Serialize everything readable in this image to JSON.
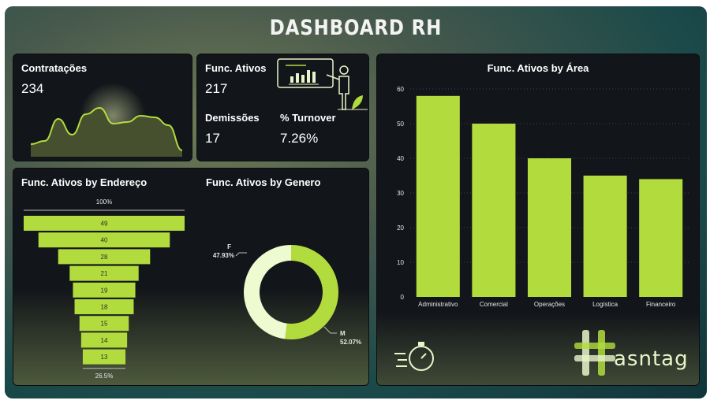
{
  "header": {
    "title": "DASHBOARD RH"
  },
  "cards": {
    "contratacoes": {
      "label": "Contratações",
      "value": "234"
    },
    "ativos": {
      "label": "Func. Ativos",
      "value": "217"
    },
    "demissoes": {
      "label": "Demissões",
      "value": "17"
    },
    "turnover": {
      "label": "% Turnover",
      "value": "7.26%"
    }
  },
  "sparkline": {
    "values": [
      8,
      10,
      24,
      14,
      27,
      31,
      21,
      22,
      26,
      25,
      20,
      4
    ]
  },
  "chart_data": [
    {
      "type": "bar",
      "title": "Func. Ativos by Endereço",
      "orientation": "funnel",
      "values": [
        49,
        40,
        28,
        21,
        19,
        18,
        15,
        14,
        13
      ],
      "top_label": "100%",
      "bottom_label": "26.5%"
    },
    {
      "type": "pie",
      "title": "Func. Ativos by Genero",
      "slices": [
        {
          "name": "F",
          "percent": "47.93%",
          "value": 47.93,
          "color": "#eefad0"
        },
        {
          "name": "M",
          "percent": "52.07%",
          "value": 52.07,
          "color": "#b2dc3e"
        }
      ]
    },
    {
      "type": "bar",
      "title": "Func. Ativos by Área",
      "categories": [
        "Administrativo",
        "Comercial",
        "Operações",
        "Logística",
        "Financeiro"
      ],
      "values": [
        58,
        50,
        40,
        35,
        34
      ],
      "yticks": [
        "0",
        "10",
        "20",
        "30",
        "40",
        "50",
        "60"
      ],
      "ylim": [
        0,
        60
      ]
    }
  ],
  "branding": {
    "logo_text": "asntag"
  },
  "colors": {
    "accent": "#b2dc3e",
    "card": "#121519"
  }
}
